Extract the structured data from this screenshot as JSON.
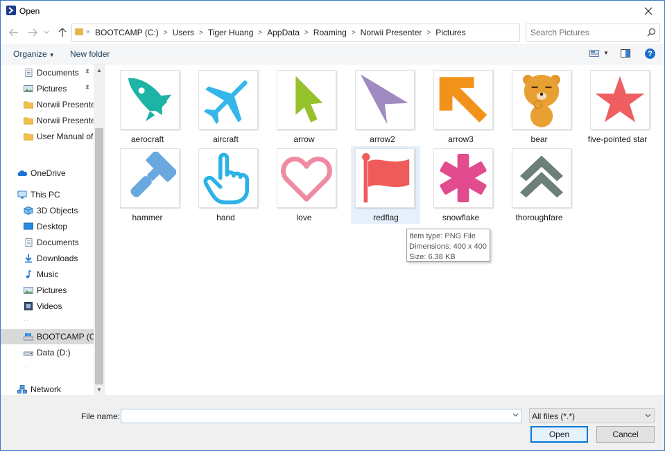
{
  "window": {
    "title": "Open",
    "close_icon": "close-icon"
  },
  "address": {
    "breadcrumbs": [
      "BOOTCAMP (C:)",
      "Users",
      "Tiger Huang",
      "AppData",
      "Roaming",
      "Norwii Presenter",
      "Pictures"
    ],
    "search_placeholder": "Search Pictures"
  },
  "toolbar": {
    "organize_label": "Organize",
    "new_folder_label": "New folder",
    "help_label": "?"
  },
  "nav": {
    "quick_items": [
      {
        "label": "Documents",
        "icon": "documents-icon",
        "pinned": true
      },
      {
        "label": "Pictures",
        "icon": "pictures-icon",
        "pinned": true
      },
      {
        "label": "Norwii Presenter",
        "icon": "folder-icon",
        "pinned": false
      },
      {
        "label": "Norwii Presenter",
        "icon": "folder-icon",
        "pinned": false
      },
      {
        "label": "User Manual of N",
        "icon": "folder-icon",
        "pinned": false
      }
    ],
    "onedrive": "OneDrive",
    "this_pc": "This PC",
    "pc_items": [
      {
        "label": "3D Objects",
        "icon": "3d-objects-icon"
      },
      {
        "label": "Desktop",
        "icon": "desktop-icon"
      },
      {
        "label": "Documents",
        "icon": "documents-icon"
      },
      {
        "label": "Downloads",
        "icon": "downloads-icon"
      },
      {
        "label": "Music",
        "icon": "music-icon"
      },
      {
        "label": "Pictures",
        "icon": "pictures-icon"
      },
      {
        "label": "Videos",
        "icon": "videos-icon"
      }
    ],
    "drives": [
      {
        "label": "BOOTCAMP (C:)",
        "icon": "drive-c-icon",
        "selected": true
      },
      {
        "label": "Data (D:)",
        "icon": "drive-d-icon",
        "selected": false
      }
    ],
    "network": "Network"
  },
  "files": [
    {
      "name": "aerocraft",
      "icon": "rocket-icon",
      "color": "#1db3a5"
    },
    {
      "name": "aircraft",
      "icon": "airplane-icon",
      "color": "#34b6ea"
    },
    {
      "name": "arrow",
      "icon": "cursor-arrow-icon",
      "color": "#95c22b"
    },
    {
      "name": "arrow2",
      "icon": "pointer-arrow-icon",
      "color": "#a08ac2"
    },
    {
      "name": "arrow3",
      "icon": "diagonal-arrow-icon",
      "color": "#f2921a"
    },
    {
      "name": "bear",
      "icon": "bear-icon",
      "color": "#e3982f"
    },
    {
      "name": "five-pointed star",
      "icon": "star-icon",
      "color": "#ef5f62"
    },
    {
      "name": "hammer",
      "icon": "hammer-icon",
      "color": "#6aa8e0"
    },
    {
      "name": "hand",
      "icon": "hand-pointer-icon",
      "color": "#2cb2e6"
    },
    {
      "name": "love",
      "icon": "heart-icon",
      "color": "#f08aa3"
    },
    {
      "name": "redflag",
      "icon": "flag-icon",
      "color": "#ef5a5a"
    },
    {
      "name": "snowflake",
      "icon": "asterisk-icon",
      "color": "#e24b8d"
    },
    {
      "name": "thoroughfare",
      "icon": "double-chevron-up-icon",
      "color": "#6c7f78"
    }
  ],
  "tooltip": {
    "type": "Item type: PNG File",
    "dimensions": "Dimensions: 400 x 400",
    "size": "Size: 6.38 KB"
  },
  "bottom": {
    "file_name_label": "File name:",
    "file_name_value": "",
    "file_type": "All files (*.*)",
    "open_label": "Open",
    "cancel_label": "Cancel"
  }
}
